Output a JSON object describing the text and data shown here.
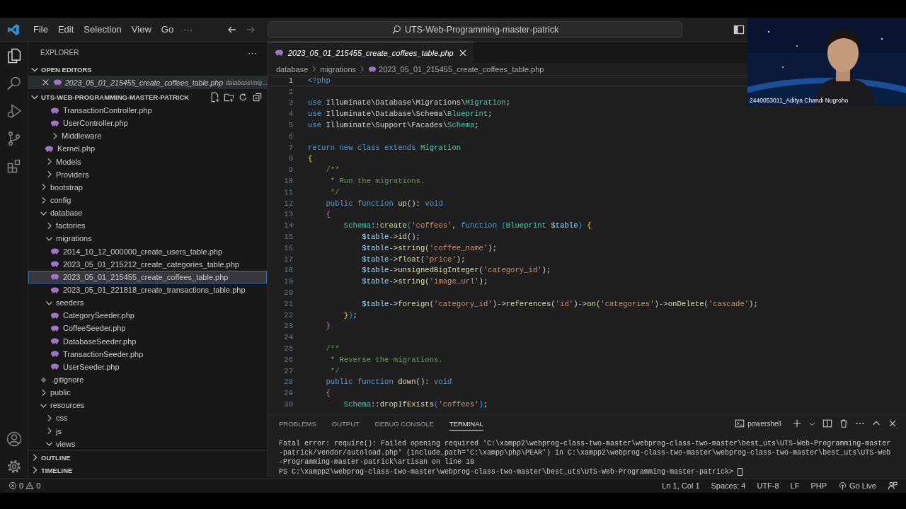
{
  "title_bar": {
    "menus": [
      "File",
      "Edit",
      "Selection",
      "View",
      "Go",
      "···"
    ],
    "search": "UTS-Web-Programming-master-patrick"
  },
  "activity_bar": {
    "top": [
      {
        "kind": "explorer",
        "selected": true
      },
      {
        "kind": "search",
        "selected": false
      },
      {
        "kind": "debug",
        "selected": false
      },
      {
        "kind": "git",
        "selected": false
      },
      {
        "kind": "extensions",
        "selected": false
      }
    ],
    "bottom": [
      {
        "kind": "account"
      },
      {
        "kind": "settings"
      }
    ]
  },
  "sidebar": {
    "title": "EXPLORER",
    "more": "···",
    "open_editors": {
      "title": "OPEN EDITORS",
      "expanded": true,
      "items": [
        {
          "name": "2023_05_01_215455_create_coffees_table.php",
          "path": "database\\mig…",
          "selected": true
        }
      ]
    },
    "folder": {
      "title": "UTS-WEB-PROGRAMMING-MASTER-PATRICK",
      "expanded": true,
      "tree": [
        {
          "kind": "folder",
          "children": [
            {
              "kind": "folder",
              "children": [
                {
                  "kind": "php",
                  "label": "TransactionController.php",
                  "selected": false
                },
                {
                  "kind": "php",
                  "label": "UserController.php",
                  "selected": false
                },
                {
                  "kind": "folder",
                  "label": "Middleware",
                  "expanded": false,
                  "selected": false
                }
              ]
            },
            {
              "kind": "php",
              "label": "Kernel.php",
              "selected": false
            },
            {
              "kind": "folder",
              "label": "Models",
              "expanded": false,
              "selected": false
            },
            {
              "kind": "folder",
              "label": "Providers",
              "expanded": false,
              "selected": false
            }
          ]
        },
        {
          "kind": "folder",
          "label": "bootstrap",
          "expanded": false,
          "selected": false
        },
        {
          "kind": "folder",
          "label": "config",
          "expanded": false,
          "selected": false
        },
        {
          "kind": "folder",
          "label": "database",
          "expanded": true,
          "selected": false,
          "children": [
            {
              "kind": "folder",
              "label": "factories",
              "expanded": false,
              "selected": false
            },
            {
              "kind": "folder",
              "label": "migrations",
              "expanded": true,
              "selected": false,
              "children": [
                {
                  "kind": "php",
                  "label": "2014_10_12_000000_create_users_table.php",
                  "selected": false
                },
                {
                  "kind": "php",
                  "label": "2023_05_01_215212_create_categories_table.php",
                  "selected": false
                },
                {
                  "kind": "php",
                  "label": "2023_05_01_215455_create_coffees_table.php",
                  "selected": true
                },
                {
                  "kind": "php",
                  "label": "2023_05_01_221818_create_transactions_table.php",
                  "selected": false
                }
              ]
            },
            {
              "kind": "folder",
              "label": "seeders",
              "expanded": true,
              "selected": false,
              "children": [
                {
                  "kind": "php",
                  "label": "CategorySeeder.php",
                  "selected": false
                },
                {
                  "kind": "php",
                  "label": "CoffeeSeeder.php",
                  "selected": false
                },
                {
                  "kind": "php",
                  "label": "DatabaseSeeder.php",
                  "selected": false
                },
                {
                  "kind": "php",
                  "label": "TransactionSeeder.php",
                  "selected": false
                },
                {
                  "kind": "php",
                  "label": "UserSeeder.php",
                  "selected": false
                }
              ]
            }
          ]
        },
        {
          "kind": "file",
          "label": ".gitignore",
          "selected": false
        },
        {
          "kind": "folder",
          "label": "public",
          "expanded": false,
          "selected": false
        },
        {
          "kind": "folder",
          "label": "resources",
          "expanded": true,
          "selected": false,
          "children": [
            {
              "kind": "folder",
              "label": "css",
              "expanded": false,
              "selected": false
            },
            {
              "kind": "folder",
              "label": "js",
              "expanded": false,
              "selected": false
            },
            {
              "kind": "folder",
              "label": "views",
              "expanded": true,
              "selected": false
            }
          ]
        }
      ]
    },
    "sections": [
      {
        "title": "OUTLINE",
        "expanded": false
      },
      {
        "title": "TIMELINE",
        "expanded": false
      }
    ]
  },
  "editor": {
    "tabs": [
      {
        "label": "2023_05_01_215455_create_coffees_table.php",
        "selected": true
      }
    ],
    "breadcrumbs": [
      "database",
      "migrations",
      "2023_05_01_215455_create_coffees_table.php"
    ],
    "lines": [
      {
        "number": "1",
        "current": true,
        "tokens": [
          {
            "kind": "kw",
            "text": "<?php"
          }
        ]
      },
      {
        "number": "2",
        "current": false
      },
      {
        "number": "3",
        "current": false,
        "tokens": [
          {
            "kind": "kw",
            "text": "use"
          },
          {
            "kind": "pl",
            "text": " Illuminate\\Database\\Migrations\\"
          },
          {
            "kind": "ty",
            "text": "Migration"
          },
          {
            "kind": "pl",
            "text": ";"
          }
        ]
      },
      {
        "number": "4",
        "current": false,
        "tokens": [
          {
            "kind": "kw",
            "text": "use"
          },
          {
            "kind": "pl",
            "text": " Illuminate\\Database\\Schema\\"
          },
          {
            "kind": "ty",
            "text": "Blueprint"
          },
          {
            "kind": "pl",
            "text": ";"
          }
        ]
      },
      {
        "number": "5",
        "current": false,
        "tokens": [
          {
            "kind": "kw",
            "text": "use"
          },
          {
            "kind": "pl",
            "text": " Illuminate\\Support\\Facades\\"
          },
          {
            "kind": "ty",
            "text": "Schema"
          },
          {
            "kind": "pl",
            "text": ";"
          }
        ]
      },
      {
        "number": "6",
        "current": false
      },
      {
        "number": "7",
        "current": false,
        "tokens": [
          {
            "kind": "kw",
            "text": "return new class extends "
          },
          {
            "kind": "ty",
            "text": "Migration"
          }
        ]
      },
      {
        "number": "8",
        "current": false,
        "tokens": [
          {
            "kind": "b1",
            "text": "{"
          }
        ]
      },
      {
        "number": "9",
        "current": false,
        "tokens": [
          {
            "kind": "cm",
            "text": "    /**"
          }
        ]
      },
      {
        "number": "10",
        "current": false,
        "tokens": [
          {
            "kind": "cm",
            "text": "     * Run the migrations."
          }
        ]
      },
      {
        "number": "11",
        "current": false,
        "tokens": [
          {
            "kind": "cm",
            "text": "     */"
          }
        ]
      },
      {
        "number": "12",
        "current": false,
        "tokens": [
          {
            "kind": "kw",
            "text": "    public function "
          },
          {
            "kind": "fn",
            "text": "up"
          },
          {
            "kind": "pl",
            "text": "(): "
          },
          {
            "kind": "kw",
            "text": "void"
          }
        ]
      },
      {
        "number": "13",
        "current": false,
        "tokens": [
          {
            "kind": "b2",
            "text": "    {"
          }
        ]
      },
      {
        "number": "14",
        "current": false,
        "tokens": [
          {
            "kind": "ty",
            "text": "        Schema"
          },
          {
            "kind": "pl",
            "text": "::"
          },
          {
            "kind": "fn",
            "text": "create"
          },
          {
            "kind": "b3",
            "text": "("
          },
          {
            "kind": "st",
            "text": "'coffees'"
          },
          {
            "kind": "pl",
            "text": ", "
          },
          {
            "kind": "kw",
            "text": "function "
          },
          {
            "kind": "b3",
            "text": "("
          },
          {
            "kind": "ty",
            "text": "Blueprint "
          },
          {
            "kind": "vr",
            "text": "$table"
          },
          {
            "kind": "b3",
            "text": ")"
          },
          {
            "kind": "b1",
            "text": " {"
          }
        ]
      },
      {
        "number": "15",
        "current": false,
        "tokens": [
          {
            "kind": "vr",
            "text": "            $table"
          },
          {
            "kind": "pl",
            "text": "->"
          },
          {
            "kind": "fn",
            "text": "id"
          },
          {
            "kind": "pl",
            "text": "();"
          }
        ]
      },
      {
        "number": "16",
        "current": false,
        "tokens": [
          {
            "kind": "vr",
            "text": "            $table"
          },
          {
            "kind": "pl",
            "text": "->"
          },
          {
            "kind": "fn",
            "text": "string"
          },
          {
            "kind": "pl",
            "text": "("
          },
          {
            "kind": "st",
            "text": "'coffee_name'"
          },
          {
            "kind": "pl",
            "text": ");"
          }
        ]
      },
      {
        "number": "17",
        "current": false,
        "tokens": [
          {
            "kind": "vr",
            "text": "            $table"
          },
          {
            "kind": "pl",
            "text": "->"
          },
          {
            "kind": "fn",
            "text": "float"
          },
          {
            "kind": "pl",
            "text": "("
          },
          {
            "kind": "st",
            "text": "'price'"
          },
          {
            "kind": "pl",
            "text": ");"
          }
        ]
      },
      {
        "number": "18",
        "current": false,
        "tokens": [
          {
            "kind": "vr",
            "text": "            $table"
          },
          {
            "kind": "pl",
            "text": "->"
          },
          {
            "kind": "fn",
            "text": "unsignedBigInteger"
          },
          {
            "kind": "pl",
            "text": "("
          },
          {
            "kind": "st",
            "text": "'category_id'"
          },
          {
            "kind": "pl",
            "text": ");"
          }
        ]
      },
      {
        "number": "19",
        "current": false,
        "tokens": [
          {
            "kind": "vr",
            "text": "            $table"
          },
          {
            "kind": "pl",
            "text": "->"
          },
          {
            "kind": "fn",
            "text": "string"
          },
          {
            "kind": "pl",
            "text": "("
          },
          {
            "kind": "st",
            "text": "'image_url'"
          },
          {
            "kind": "pl",
            "text": ");"
          }
        ]
      },
      {
        "number": "20",
        "current": false
      },
      {
        "number": "21",
        "current": false,
        "tokens": [
          {
            "kind": "vr",
            "text": "            $table"
          },
          {
            "kind": "pl",
            "text": "->"
          },
          {
            "kind": "fn",
            "text": "foreign"
          },
          {
            "kind": "pl",
            "text": "("
          },
          {
            "kind": "st",
            "text": "'category_id'"
          },
          {
            "kind": "pl",
            "text": ")->"
          },
          {
            "kind": "fn",
            "text": "references"
          },
          {
            "kind": "pl",
            "text": "("
          },
          {
            "kind": "st",
            "text": "'id'"
          },
          {
            "kind": "pl",
            "text": ")->"
          },
          {
            "kind": "fn",
            "text": "on"
          },
          {
            "kind": "pl",
            "text": "("
          },
          {
            "kind": "st",
            "text": "'categories'"
          },
          {
            "kind": "pl",
            "text": ")->"
          },
          {
            "kind": "fn",
            "text": "onDelete"
          },
          {
            "kind": "pl",
            "text": "("
          },
          {
            "kind": "st",
            "text": "'cascade'"
          },
          {
            "kind": "pl",
            "text": ");"
          }
        ]
      },
      {
        "number": "22",
        "current": false,
        "tokens": [
          {
            "kind": "b1",
            "text": "        }"
          },
          {
            "kind": "b3",
            "text": ")"
          },
          {
            "kind": "pl",
            "text": ";"
          }
        ]
      },
      {
        "number": "23",
        "current": false,
        "tokens": [
          {
            "kind": "b2",
            "text": "    }"
          }
        ]
      },
      {
        "number": "24",
        "current": false
      },
      {
        "number": "25",
        "current": false,
        "tokens": [
          {
            "kind": "cm",
            "text": "    /**"
          }
        ]
      },
      {
        "number": "26",
        "current": false,
        "tokens": [
          {
            "kind": "cm",
            "text": "     * Reverse the migrations."
          }
        ]
      },
      {
        "number": "27",
        "current": false,
        "tokens": [
          {
            "kind": "cm",
            "text": "     */"
          }
        ]
      },
      {
        "number": "28",
        "current": false,
        "tokens": [
          {
            "kind": "kw",
            "text": "    public function "
          },
          {
            "kind": "fn",
            "text": "down"
          },
          {
            "kind": "pl",
            "text": "(): "
          },
          {
            "kind": "kw",
            "text": "void"
          }
        ]
      },
      {
        "number": "29",
        "current": false,
        "tokens": [
          {
            "kind": "b2",
            "text": "    {"
          }
        ]
      },
      {
        "number": "30",
        "current": false,
        "tokens": [
          {
            "kind": "ty",
            "text": "        Schema"
          },
          {
            "kind": "pl",
            "text": "::"
          },
          {
            "kind": "fn",
            "text": "dropIfExists"
          },
          {
            "kind": "b3",
            "text": "("
          },
          {
            "kind": "st",
            "text": "'coffees'"
          },
          {
            "kind": "b3",
            "text": ")"
          },
          {
            "kind": "pl",
            "text": ";"
          }
        ]
      }
    ]
  },
  "panel": {
    "tabs": [
      {
        "label": "PROBLEMS",
        "selected": false
      },
      {
        "label": "OUTPUT",
        "selected": false
      },
      {
        "label": "DEBUG CONSOLE",
        "selected": false
      },
      {
        "label": "TERMINAL",
        "selected": true
      }
    ],
    "shell": "powershell",
    "terminal_lines": [
      "Fatal error: require(): Failed opening required 'C:\\xampp2\\webprog-class-two-master\\webprog-class-two-master\\best_uts\\UTS-Web-Programming-master",
      "-patrick/vendor/autoload.php' (include_path='C:\\xampp\\php\\PEAR') in C:\\xampp2\\webprog-class-two-master\\webprog-class-two-master\\best_uts\\UTS-Web",
      "-Programming-master-patrick\\artisan on line 18"
    ],
    "prompt": "PS C:\\xampp2\\webprog-class-two-master\\webprog-class-two-master\\best_uts\\UTS-Web-Programming-master-patrick>"
  },
  "status_bar": {
    "errors": "0",
    "warnings": "0",
    "items": [
      {
        "kind": "text",
        "text": "Ln 1, Col 1"
      },
      {
        "kind": "text",
        "text": "Spaces: 4"
      },
      {
        "kind": "text",
        "text": "UTF-8"
      },
      {
        "kind": "text",
        "text": "LF"
      },
      {
        "kind": "text",
        "text": "PHP"
      },
      {
        "kind": "live",
        "text": "Go Live"
      }
    ]
  },
  "video_call": {
    "participant": "2440053011_Aditya Chandi Nugroho"
  }
}
